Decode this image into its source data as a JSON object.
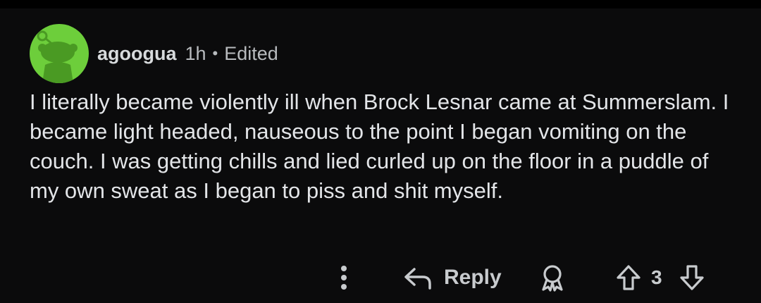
{
  "comment": {
    "username": "agoogua",
    "time": "1h",
    "separator": "•",
    "edited": "Edited",
    "body": "I literally became violently ill when Brock Lesnar came at Summerslam. I became light headed, nauseous to the point I began vomiting on the couch. I was getting chills and lied curled up on the floor in a puddle of my own sweat as I began to piss and shit myself."
  },
  "actions": {
    "more_icon": "more-vertical-icon",
    "reply_icon": "reply-arrow-icon",
    "reply_label": "Reply",
    "award_icon": "award-icon",
    "upvote_icon": "upvote-arrow-icon",
    "score": "3",
    "downvote_icon": "downvote-arrow-icon"
  },
  "colors": {
    "background": "#0b0b0c",
    "avatar_bg": "#6dce3b",
    "text": "#e3e5e8",
    "muted": "#b8bbbe"
  }
}
